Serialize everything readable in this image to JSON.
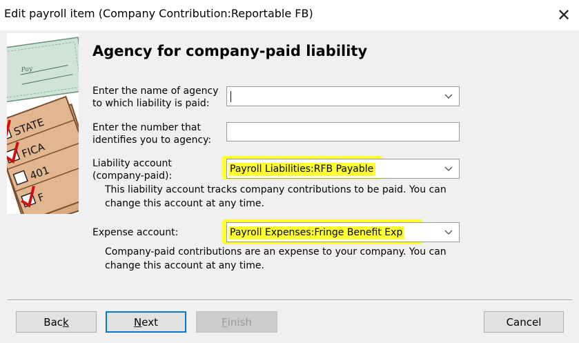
{
  "window": {
    "title": "Edit payroll item (Company Contribution:Reportable FB)",
    "close_glyph": "✕"
  },
  "page": {
    "heading": "Agency for company-paid liability"
  },
  "art": {
    "labels": [
      "STATE",
      "FICA",
      "401",
      "F"
    ],
    "icon": "payroll-checks-illustration"
  },
  "form": {
    "agency_name": {
      "label_line1": "Enter the name of agency",
      "label_line2": "to which liability is paid:",
      "value": ""
    },
    "agency_number": {
      "label_line1": "Enter the number that",
      "label_line2": "identifies you to agency:",
      "value": ""
    },
    "liability_account": {
      "label_line1": "Liability account",
      "label_line2": "(company-paid):",
      "value": "Payroll Liabilities:RFB Payable",
      "note_line1": "This liability account tracks company contributions to be paid. You can",
      "note_line2": "change this account at any time."
    },
    "expense_account": {
      "label": "Expense account:",
      "value": "Payroll Expenses:Fringe Benefit Exp",
      "note_line1": "Company-paid contributions are an expense to your company. You can",
      "note_line2": "change this account at any time."
    }
  },
  "buttons": {
    "back": {
      "pre": "Bac",
      "mnemonic": "k",
      "post": ""
    },
    "next": {
      "pre": "",
      "mnemonic": "N",
      "post": "ext"
    },
    "finish": {
      "pre": "",
      "mnemonic": "F",
      "post": "inish"
    },
    "cancel": {
      "label": "Cancel"
    }
  },
  "colors": {
    "highlight": "#ffff2e",
    "focus_border": "#0078d7"
  }
}
